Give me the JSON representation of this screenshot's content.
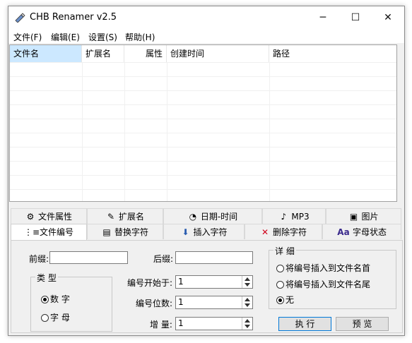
{
  "window": {
    "title": "CHB Renamer v2.5",
    "min_glyph": "─",
    "max_glyph": "☐",
    "close_glyph": "✕"
  },
  "menu": [
    "文件(F)",
    "编辑(E)",
    "设置(S)",
    "帮助(H)"
  ],
  "columns": [
    "文件名",
    "扩展名",
    "属性",
    "创建时间",
    "路径"
  ],
  "tabs_row1": [
    {
      "label": "文件属性",
      "icon": "file-attributes-icon",
      "glyph": "⚙"
    },
    {
      "label": "扩展名",
      "icon": "extension-icon",
      "glyph": "✎"
    },
    {
      "label": "日期-时间",
      "icon": "clock-icon",
      "glyph": "◔"
    },
    {
      "label": "MP3",
      "icon": "music-file-icon",
      "glyph": "♪"
    },
    {
      "label": "图片",
      "icon": "picture-icon",
      "glyph": "▣"
    }
  ],
  "tabs_row2": [
    {
      "label": "文件编号",
      "icon": "numbered-list-icon",
      "glyph": "⋮≡"
    },
    {
      "label": "替换字符",
      "icon": "replace-icon",
      "glyph": "▤"
    },
    {
      "label": "插入字符",
      "icon": "insert-icon",
      "glyph": "⬇"
    },
    {
      "label": "删除字符",
      "icon": "delete-icon",
      "glyph": "✕"
    },
    {
      "label": "字母状态",
      "icon": "letter-case-icon",
      "glyph": "Aa"
    }
  ],
  "panel": {
    "prefix_label": "前缀:",
    "prefix_value": "",
    "suffix_label": "后缀:",
    "suffix_value": "",
    "type_group": {
      "title": "类 型",
      "options": [
        "数 字",
        "字 母"
      ],
      "selected": 0
    },
    "start_label": "编号开始于:",
    "start_value": "1",
    "digits_label": "编号位数:",
    "digits_value": "1",
    "step_label": "增 量:",
    "step_value": "1",
    "detail_group": {
      "title": "详 细",
      "options": [
        "将编号插入到文件名首",
        "将编号插入到文件名尾",
        "无"
      ],
      "selected": 2
    },
    "execute_label": "执 行",
    "preview_label": "预 览"
  },
  "colors": {
    "selected_header": "#cce8ff",
    "delete_icon": "#d0021b",
    "aa_icon": "#3a2a8c"
  }
}
